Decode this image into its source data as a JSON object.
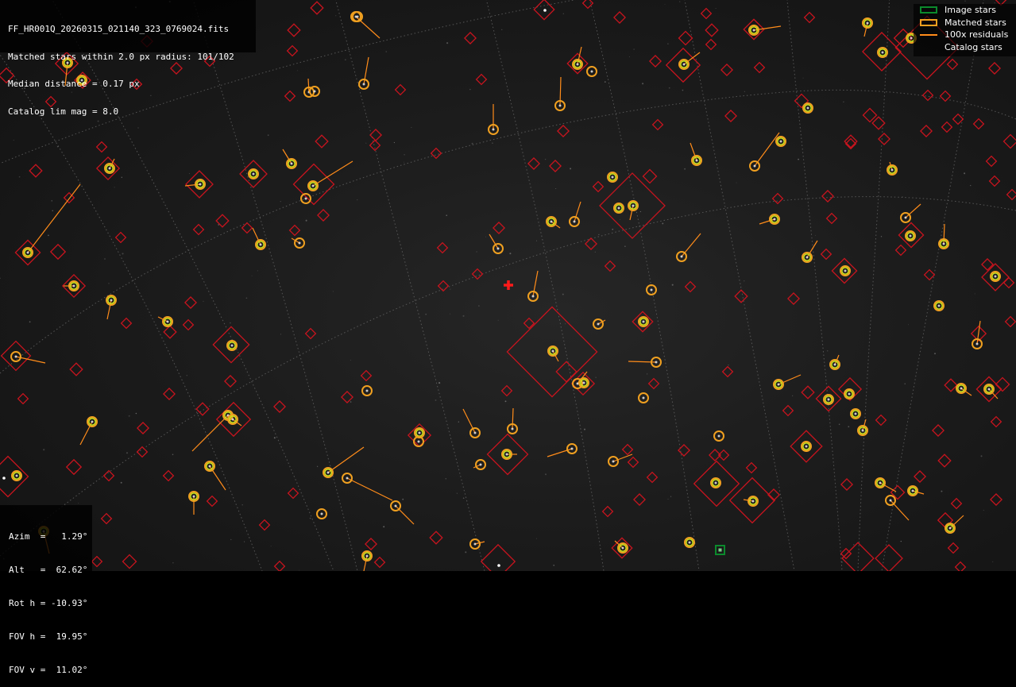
{
  "info": {
    "lines": [
      "FF_HR001Q_20260315_021140_323_0769024.fits",
      "Matched stars within 2.0 px radius: 101/102",
      "Median distance = 0.17 px",
      "Catalog lim mag = 8.0"
    ]
  },
  "pointing": {
    "azim": "Azim  =   1.29°",
    "alt": "Alt   =  62.62°",
    "rot": "Rot h = -10.93°",
    "fovh": "FOV h =  19.95°",
    "fovv": "FOV v =  11.02°"
  },
  "legend": {
    "image_stars": "Image stars",
    "matched_stars": "Matched stars",
    "residuals": "100x residuals",
    "catalog_stars": "Catalog stars"
  },
  "colors": {
    "catalog": "#c8141e",
    "matched_ring": "#f0a020",
    "matched_core": "#c8e020",
    "residual": "#ff8c1a",
    "image_box": "#0b8a2c",
    "center_cross": "#ff1a1a",
    "grid": "#6a6a6a"
  }
}
